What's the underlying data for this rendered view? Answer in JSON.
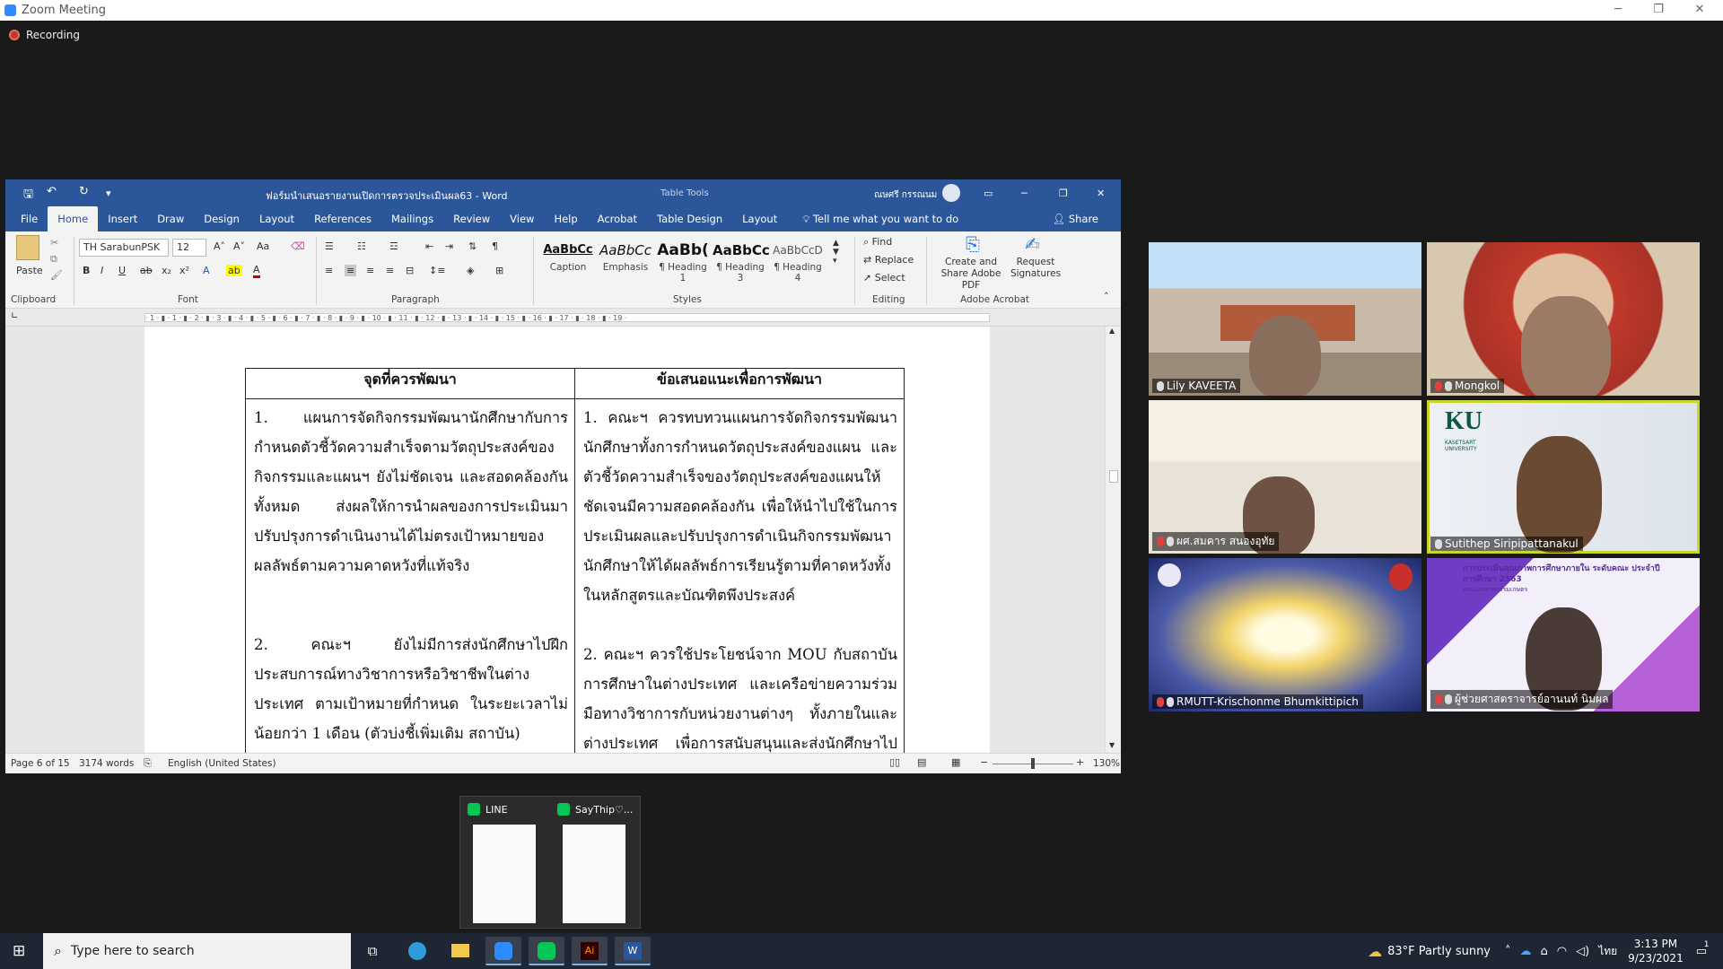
{
  "zoom": {
    "window_title": "Zoom Meeting",
    "recording_label": "Recording"
  },
  "word": {
    "doc_title": "ฟอร์มนำเสนอรายงานเปิดการตรวจประเมินผล63 - Word",
    "table_tools": "Table Tools",
    "user_name": "ณษศรี กรรณนม",
    "tabs": [
      "File",
      "Home",
      "Insert",
      "Draw",
      "Design",
      "Layout",
      "References",
      "Mailings",
      "Review",
      "View",
      "Help",
      "Acrobat",
      "Table Design",
      "Layout"
    ],
    "tell_me": "Tell me what you want to do",
    "share": "Share",
    "ribbon": {
      "paste": "Paste",
      "font_name": "TH SarabunPSK",
      "font_size": "12",
      "groups": [
        "Clipboard",
        "Font",
        "Paragraph",
        "Styles",
        "Editing",
        "Adobe Acrobat"
      ],
      "styles": [
        {
          "preview": "AaBbCc",
          "name": "Caption"
        },
        {
          "preview": "AaBbCc",
          "name": "Emphasis"
        },
        {
          "preview": "AaBb(",
          "name": "¶ Heading 1"
        },
        {
          "preview": "AaBbCc",
          "name": "¶ Heading 3"
        },
        {
          "preview": "AaBbCcD",
          "name": "¶ Heading 4"
        }
      ],
      "editing": [
        "Find",
        "Replace",
        "Select"
      ],
      "acrobat": [
        "Create and Share Adobe PDF",
        "Request Signatures"
      ]
    },
    "ruler_text": "· 1 · ▮ · 1 · ▮ · 2 · ▮ · 3 · ▮ · 4 · ▮ · 5 · ▮ · 6 · ▮ · 7 · ▮ · 8 · ▮ · 9 · ▮ · 10 · ▮ · 11 · ▮ · 12 · ▮ · 13 · ▮ · 14 · ▮ · 15 · ▮ · 16 · ▮ · 17 · ▮ · 18 · ▮ · 19 ·",
    "table": {
      "headers": [
        "จุดที่ควรพัฒนา",
        "ข้อเสนอแนะเพื่อการพัฒนา"
      ],
      "left": [
        "1. แผนการจัดกิจกรรมพัฒนานักศึกษากับการกำหนดตัวชี้วัดความสำเร็จตามวัตถุประสงค์ของกิจกรรมและแผนฯ ยังไม่ชัดเจน และสอดคล้องกันทั้งหมด ส่งผลให้การนำผลของการประเมินมาปรับปรุงการดำเนินงานได้ไม่ตรงเป้าหมายของผลลัพธ์ตามความคาดหวังที่แท้จริง",
        "2. คณะฯ ยังไม่มีการส่งนักศึกษาไปฝึกประสบการณ์ทางวิชาการหรือวิชาชีพในต่างประเทศ ตามเป้าหมายที่กำหนด ในระยะเวลาไม่น้อยกว่า 1 เดือน (ตัวบ่งชี้เพิ่มเติม สถาบัน)"
      ],
      "right": [
        "1. คณะฯ ควรทบทวนแผนการจัดกิจกรรมพัฒนานักศึกษาทั้งการกำหนดวัตถุประสงค์ของแผน และตัวชี้วัดความสำเร็จของวัตถุประสงค์ของแผนให้ชัดเจนมีความสอดคล้องกัน เพื่อให้นำไปใช้ในการประเมินผลและปรับปรุงการดำเนินกิจกรรมพัฒนานักศึกษาให้ได้ผลลัพธ์การเรียนรู้ตามที่คาดหวังทั้งในหลักสูตรและบัณฑิตพึงประสงค์",
        "2. คณะฯ ควรใช้ประโยชน์จาก MOU กับสถาบันการศึกษาในต่างประเทศ และเครือข่ายความร่วมมือทางวิชาการกับหน่วยงานต่างๆ ทั้งภายในและต่างประเทศ เพื่อการสนับสนุนและส่งนักศึกษาไปฝึก"
      ]
    },
    "status": {
      "page": "Page 6 of 15",
      "words": "3174 words",
      "language": "English (United States)",
      "zoom": "130%"
    }
  },
  "participants": [
    {
      "name": "Lily KAVEETA",
      "muted": false
    },
    {
      "name": "Mongkol",
      "muted": true
    },
    {
      "name": "ผศ.สมคาร สนองอุทัย",
      "muted": true
    },
    {
      "name": "Sutithep Siripipattanakul",
      "muted": false
    },
    {
      "name": "RMUTT-Krischonme Bhumkittipich",
      "muted": true
    },
    {
      "name": "ผู้ช่วยศาสตราจารย์อานนท์ นิมผล",
      "muted": true
    }
  ],
  "tile_text": {
    "ku_logo": "KU",
    "ku_sub": "KASETSART UNIVERSITY",
    "banner_title": "การประเมินคุณภาพการศึกษาภายใน ระดับคณะ ประจำปีการศึกษา 2563",
    "banner_sub": "คณะอุตสาหกรรมเกษตร"
  },
  "previews": [
    {
      "name": "LINE"
    },
    {
      "name": "SayThip♡..."
    }
  ],
  "taskbar": {
    "search_placeholder": "Type here to search",
    "weather": "83°F  Partly sunny",
    "lang": "ไทย",
    "time": "3:13 PM",
    "date": "9/23/2021",
    "notif_count": "1"
  }
}
